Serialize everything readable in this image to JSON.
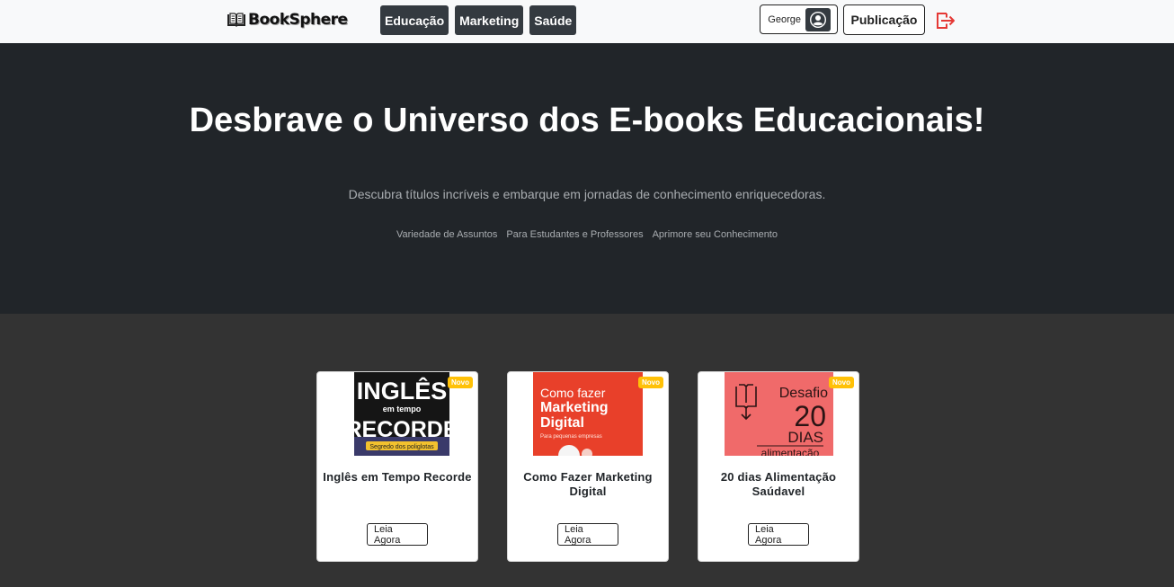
{
  "brand": {
    "name": "BookSphere"
  },
  "nav": {
    "categories": [
      "Educação",
      "Marketing",
      "Saúde"
    ],
    "user_name": "George",
    "publish_label": "Publicação"
  },
  "hero": {
    "title": "Desbrave o Universo dos E-books Educacionais!",
    "subtitle": "Descubra títulos incríveis e embarque em jornadas de conhecimento enriquecedoras.",
    "tags": [
      "Variedade de Assuntos",
      "Para Estudantes e Professores",
      "Aprimore seu Conhecimento"
    ]
  },
  "books": [
    {
      "title": "Inglês em Tempo Recorde",
      "badge": "Novo",
      "cta": "Leia Agora",
      "cover": {
        "line1": "INGLÊS",
        "line2": "em tempo",
        "line3": "RECORDE",
        "line4": "Segredo dos poliglotas"
      }
    },
    {
      "title": "Como Fazer Marketing Digital",
      "badge": "Novo",
      "cta": "Leia Agora",
      "cover": {
        "line1": "Como fazer",
        "line2": "Marketing",
        "line3": "Digital",
        "line4": "Para pequenas empresas"
      }
    },
    {
      "title": "20 dias Alimentação Saúdavel",
      "badge": "Novo",
      "cta": "Leia Agora",
      "cover": {
        "line1": "Desafio",
        "line2": "20",
        "line3": "DIAS",
        "line4": "alimentação"
      }
    }
  ],
  "colors": {
    "navbar_bg": "#f8f9fa",
    "hero_bg": "#212529",
    "page_bg": "#333333",
    "nav_button_bg": "#343a40",
    "badge": "#ffc107",
    "logout_icon": "#e53935",
    "cover_english_bg": "#1a1a1a",
    "cover_marketing_bg": "#e8402a",
    "cover_health_bg": "#f06a6a"
  },
  "icons": {
    "brand": "open-book-icon",
    "avatar": "user-circle-icon",
    "logout": "logout-icon"
  }
}
